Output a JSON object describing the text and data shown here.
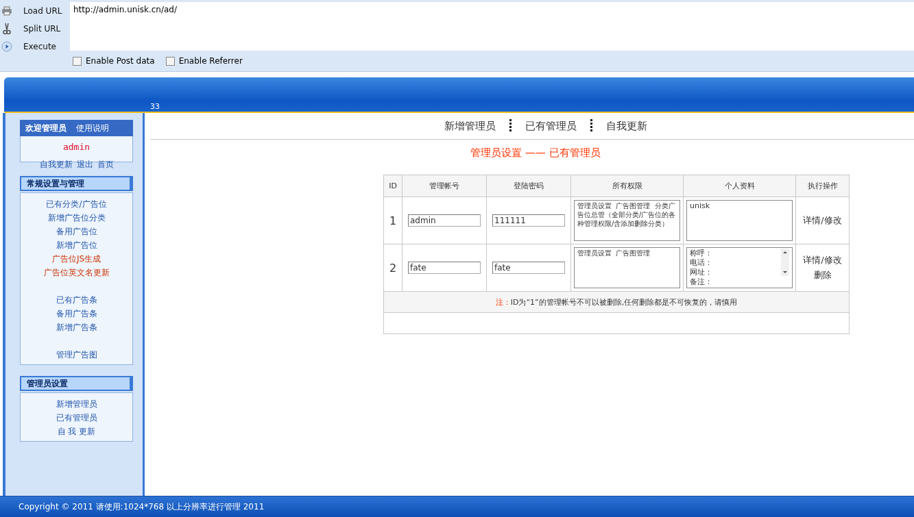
{
  "hackbar": {
    "buttons": [
      {
        "label": "Load URL",
        "kind": "load"
      },
      {
        "label": "Split URL",
        "kind": "split"
      },
      {
        "label": "Execute",
        "kind": "execute"
      }
    ],
    "url": "http://admin.unisk.cn/ad/",
    "options": [
      {
        "label": "Enable Post data",
        "checked": false
      },
      {
        "label": "Enable Referrer",
        "checked": false
      }
    ]
  },
  "header": {
    "text": "33"
  },
  "sidebar": {
    "welcome": {
      "title": "欢迎管理员",
      "help": "使用说明",
      "user": "admin",
      "links": [
        "自我更新",
        "退出",
        "首页"
      ]
    },
    "sections": [
      {
        "title": "常规设置与管理",
        "groups": [
          [
            {
              "label": "已有分类/广告位",
              "highlighted": false
            },
            {
              "label": "新增广告位分类",
              "highlighted": false
            },
            {
              "label": "备用广告位",
              "highlighted": false
            },
            {
              "label": "新增广告位",
              "highlighted": false
            },
            {
              "label": "广告位JS生成",
              "highlighted": true
            },
            {
              "label": "广告位英文名更新",
              "highlighted": true
            }
          ],
          [
            {
              "label": "已有广告条",
              "highlighted": false
            },
            {
              "label": "备用广告条",
              "highlighted": false
            },
            {
              "label": "新增广告条",
              "highlighted": false
            }
          ],
          [
            {
              "label": "管理广告图",
              "highlighted": false
            }
          ]
        ]
      },
      {
        "title": "管理员设置",
        "groups": [
          [
            {
              "label": "新增管理员",
              "highlighted": false
            },
            {
              "label": "已有管理员",
              "highlighted": false
            },
            {
              "label": "自 我 更新",
              "highlighted": false
            }
          ]
        ]
      }
    ]
  },
  "tabs": [
    {
      "label": "新增管理员"
    },
    {
      "label": "已有管理员"
    },
    {
      "label": "自我更新"
    }
  ],
  "page_title": "管理员设置 —— 已有管理员",
  "table": {
    "columns": [
      "ID",
      "管理帐号",
      "登陆密码",
      "所有权限",
      "个人资料",
      "执行操作"
    ],
    "rows": [
      {
        "id": "1",
        "account": "admin",
        "password": "111111",
        "permissions": "管理员设置  广告图管理  分类广告位总管（全部分类/广告位的各种管理权限/含添加删除分类）",
        "profile": [
          "unisk"
        ],
        "actions": [
          "详情/修改"
        ]
      },
      {
        "id": "2",
        "account": "fate",
        "password": "fate",
        "permissions": "管理员设置  广告图管理",
        "profile": [
          "称呼：",
          "电话：",
          "网址：",
          "备注："
        ],
        "actions": [
          "详情/修改",
          "删除"
        ]
      }
    ],
    "note_label": "注：",
    "note": "ID为“1”的管理帐号不可以被删除,任何删除都是不可恢复的，请慎用"
  },
  "footer": "Copyright © 2011 请使用:1024*768 以上分辨率进行管理 2011"
}
